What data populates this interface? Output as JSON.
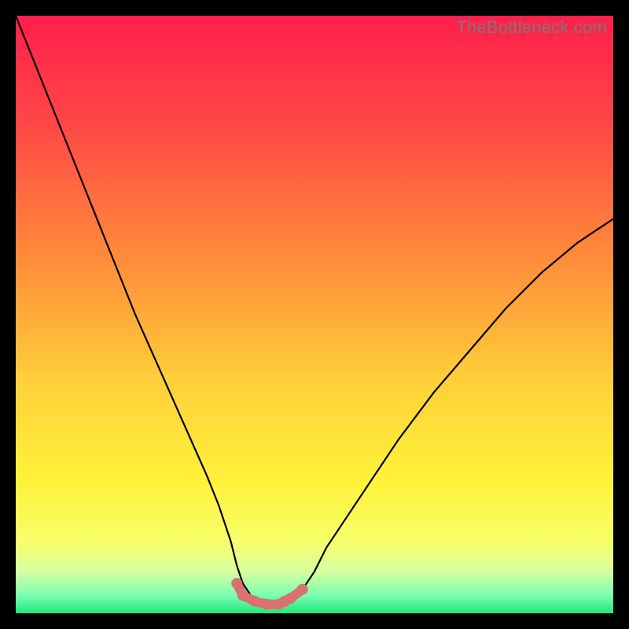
{
  "watermark": "TheBottleneck.com",
  "colors": {
    "gradient_stops": [
      {
        "offset": 0.0,
        "color": "#ff1f4b"
      },
      {
        "offset": 0.18,
        "color": "#ff4747"
      },
      {
        "offset": 0.4,
        "color": "#ff8a3a"
      },
      {
        "offset": 0.62,
        "color": "#ffd23a"
      },
      {
        "offset": 0.78,
        "color": "#fff23a"
      },
      {
        "offset": 0.88,
        "color": "#f7ff6a"
      },
      {
        "offset": 0.93,
        "color": "#d6ffa0"
      },
      {
        "offset": 0.97,
        "color": "#7affb0"
      },
      {
        "offset": 1.0,
        "color": "#22e57f"
      }
    ],
    "curve": "#000000",
    "marker": "#d9716e",
    "frame_bg": "#000000"
  },
  "chart_data": {
    "type": "line",
    "title": "",
    "xlabel": "",
    "ylabel": "",
    "xlim": [
      0,
      100
    ],
    "ylim": [
      0,
      100
    ],
    "grid": false,
    "legend": false,
    "series": [
      {
        "name": "bottleneck-curve",
        "x": [
          0,
          4,
          8,
          12,
          16,
          20,
          24,
          28,
          32,
          34,
          36,
          37,
          38,
          40,
          42,
          44,
          46,
          48,
          50,
          52,
          56,
          60,
          64,
          70,
          76,
          82,
          88,
          94,
          100
        ],
        "y": [
          100,
          90,
          80,
          70,
          60,
          50,
          41,
          32,
          23,
          18,
          12,
          8,
          5,
          2,
          1.5,
          1.5,
          2,
          4,
          7,
          11,
          17,
          23,
          29,
          37,
          44,
          51,
          57,
          62,
          66
        ]
      }
    ],
    "bottom_markers": {
      "name": "optimal-range",
      "x": [
        37,
        38,
        40,
        42,
        44,
        45,
        46,
        48
      ],
      "y": [
        5,
        3,
        2,
        1.5,
        1.5,
        2,
        2.5,
        4
      ]
    }
  }
}
